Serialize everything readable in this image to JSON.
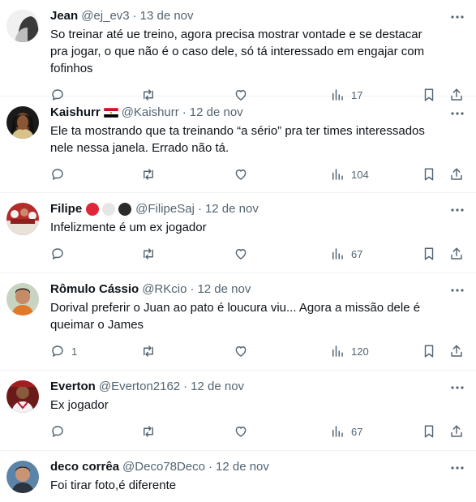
{
  "tweets": [
    {
      "name": "Jean",
      "handle": "@ej_ev3",
      "date": "13 de nov",
      "text": "So treinar até ue treino, agora precisa mostrar vontade e se destacar pra jogar, o que não é o caso dele, só tá interessado em engajar com fofinhos",
      "replies": "",
      "views": "17"
    },
    {
      "name": "Kaishurr",
      "handle": "@Kaishurr",
      "date": "12 de nov",
      "text": "Ele ta mostrando que ta treinando “a sério” pra ter times interessados nele nessa janela. Errado não tá.",
      "replies": "",
      "views": "104"
    },
    {
      "name": "Filipe",
      "handle": "@FilipeSaj",
      "date": "12 de nov",
      "text": "Infelizmente é um ex jogador",
      "replies": "",
      "views": "67"
    },
    {
      "name": "Rômulo Cássio",
      "handle": "@RKcio",
      "date": "12 de nov",
      "text": "Dorival preferir o Juan ao pato é loucura viu... Agora a missão dele é queimar o James",
      "replies": "1",
      "views": "120"
    },
    {
      "name": "Everton",
      "handle": "@Everton2162",
      "date": "12 de nov",
      "text": "Ex jogador",
      "replies": "",
      "views": "67"
    },
    {
      "name": "deco corrêa",
      "handle": "@Deco78Deco",
      "date": "12 de nov",
      "text": "Foi tirar foto,é diferente",
      "replies": "",
      "views": ""
    }
  ],
  "separator": "·",
  "colors": {
    "muted": "#536471",
    "text": "#0f1419",
    "border": "#eff3f4"
  },
  "icons": [
    "more-icon",
    "reply-icon",
    "retweet-icon",
    "like-icon",
    "views-icon",
    "bookmark-icon",
    "share-icon"
  ]
}
